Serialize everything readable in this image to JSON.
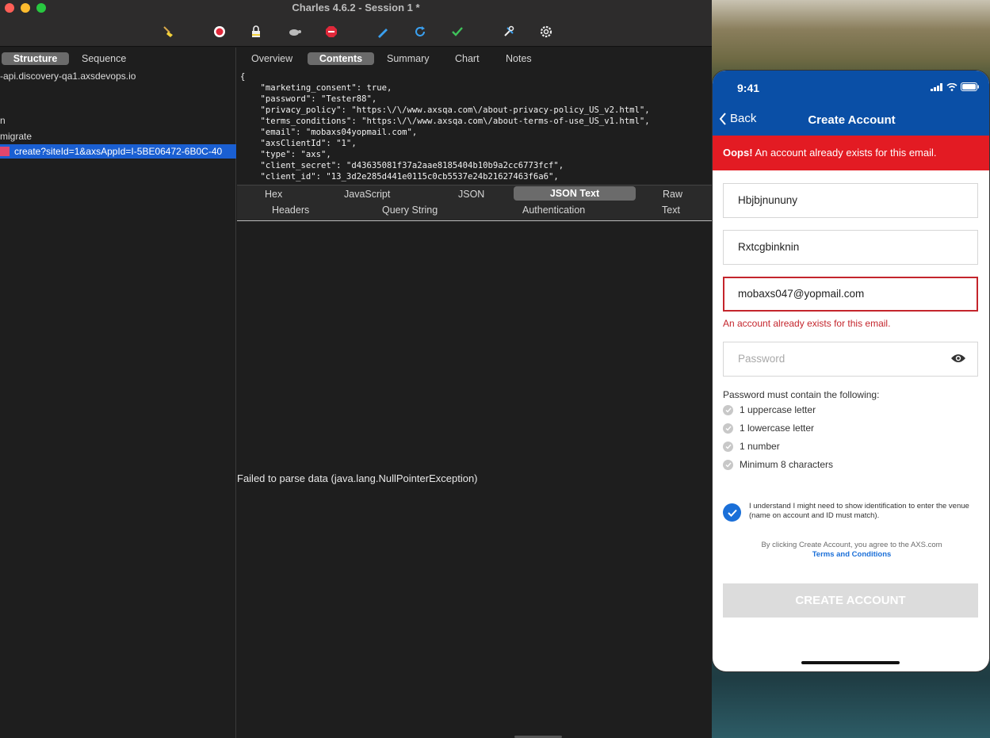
{
  "charles": {
    "title": "Charles 4.6.2 - Session 1 *",
    "view_tabs": [
      "Structure",
      "Sequence"
    ],
    "tree": {
      "host": "-api.discovery-qa1.axsdevops.io",
      "item_n": "n",
      "item_migrate": "migrate",
      "selected": "create?siteId=1&axsAppId=I-5BE06472-6B0C-40"
    },
    "detail_tabs": [
      "Overview",
      "Contents",
      "Summary",
      "Chart",
      "Notes"
    ],
    "request_body": "{\n    \"marketing_consent\": true,\n    \"password\": \"Tester88\",\n    \"privacy_policy\": \"https:\\/\\/www.axsqa.com\\/about-privacy-policy_US_v2.html\",\n    \"terms_conditions\": \"https:\\/\\/www.axsqa.com\\/about-terms-of-use_US_v1.html\",\n    \"email\": \"mobaxs04yopmail.com\",\n    \"axsClientId\": \"1\",\n    \"type\": \"axs\",\n    \"client_secret\": \"d43635081f37a2aae8185404b10b9a2cc6773fcf\",\n    \"client_id\": \"13_3d2e285d441e0115c0cb5537e24b21627463f6a6\",",
    "format_tabs_row1": [
      "Hex",
      "JavaScript",
      "JSON",
      "JSON Text",
      "Raw"
    ],
    "format_tabs_row2": [
      "Headers",
      "Query String",
      "Authentication",
      "Text"
    ],
    "response_error": "Failed to parse data (java.lang.NullPointerException)"
  },
  "phone": {
    "time": "9:41",
    "back_label": "Back",
    "screen_title": "Create Account",
    "banner_bold": "Oops!",
    "banner_text": " An account already exists for this email.",
    "first_name": "Hbjbjnununy",
    "last_name": "Rxtcgbinknin",
    "email": "mobaxs047@yopmail.com",
    "email_error": "An account already exists for this email.",
    "password_placeholder": "Password",
    "rules_title": "Password must contain the following:",
    "rules": [
      "1 uppercase letter",
      "1 lowercase letter",
      "1 number",
      "Minimum 8 characters"
    ],
    "consent_text": "I understand I might need to show identification to enter the venue (name on account and ID must match).",
    "terms_prefix": "By clicking Create Account, you agree to the AXS.com",
    "terms_link": "Terms and Conditions",
    "create_button": "CREATE ACCOUNT"
  },
  "colors": {
    "header_blue": "#0a4fa6",
    "error_red": "#e31b23",
    "selection_blue": "#1a5fd2"
  }
}
